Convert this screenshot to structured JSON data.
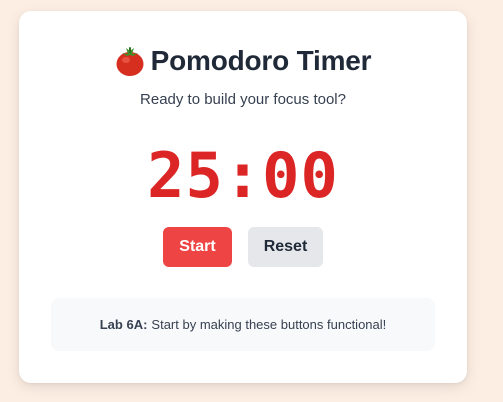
{
  "app": {
    "title": "Pomodoro Timer",
    "subtitle": "Ready to build your focus tool?",
    "timer_display": "25:00"
  },
  "controls": {
    "start_label": "Start",
    "reset_label": "Reset"
  },
  "note": {
    "label": "Lab 6A:",
    "text": "Start by making these buttons functional!"
  },
  "icons": {
    "title_icon": "tomato-icon"
  },
  "colors": {
    "background": "#fdeee3",
    "card": "#ffffff",
    "timer": "#dc2626",
    "start_button": "#ef4444",
    "reset_button": "#e5e7eb"
  }
}
